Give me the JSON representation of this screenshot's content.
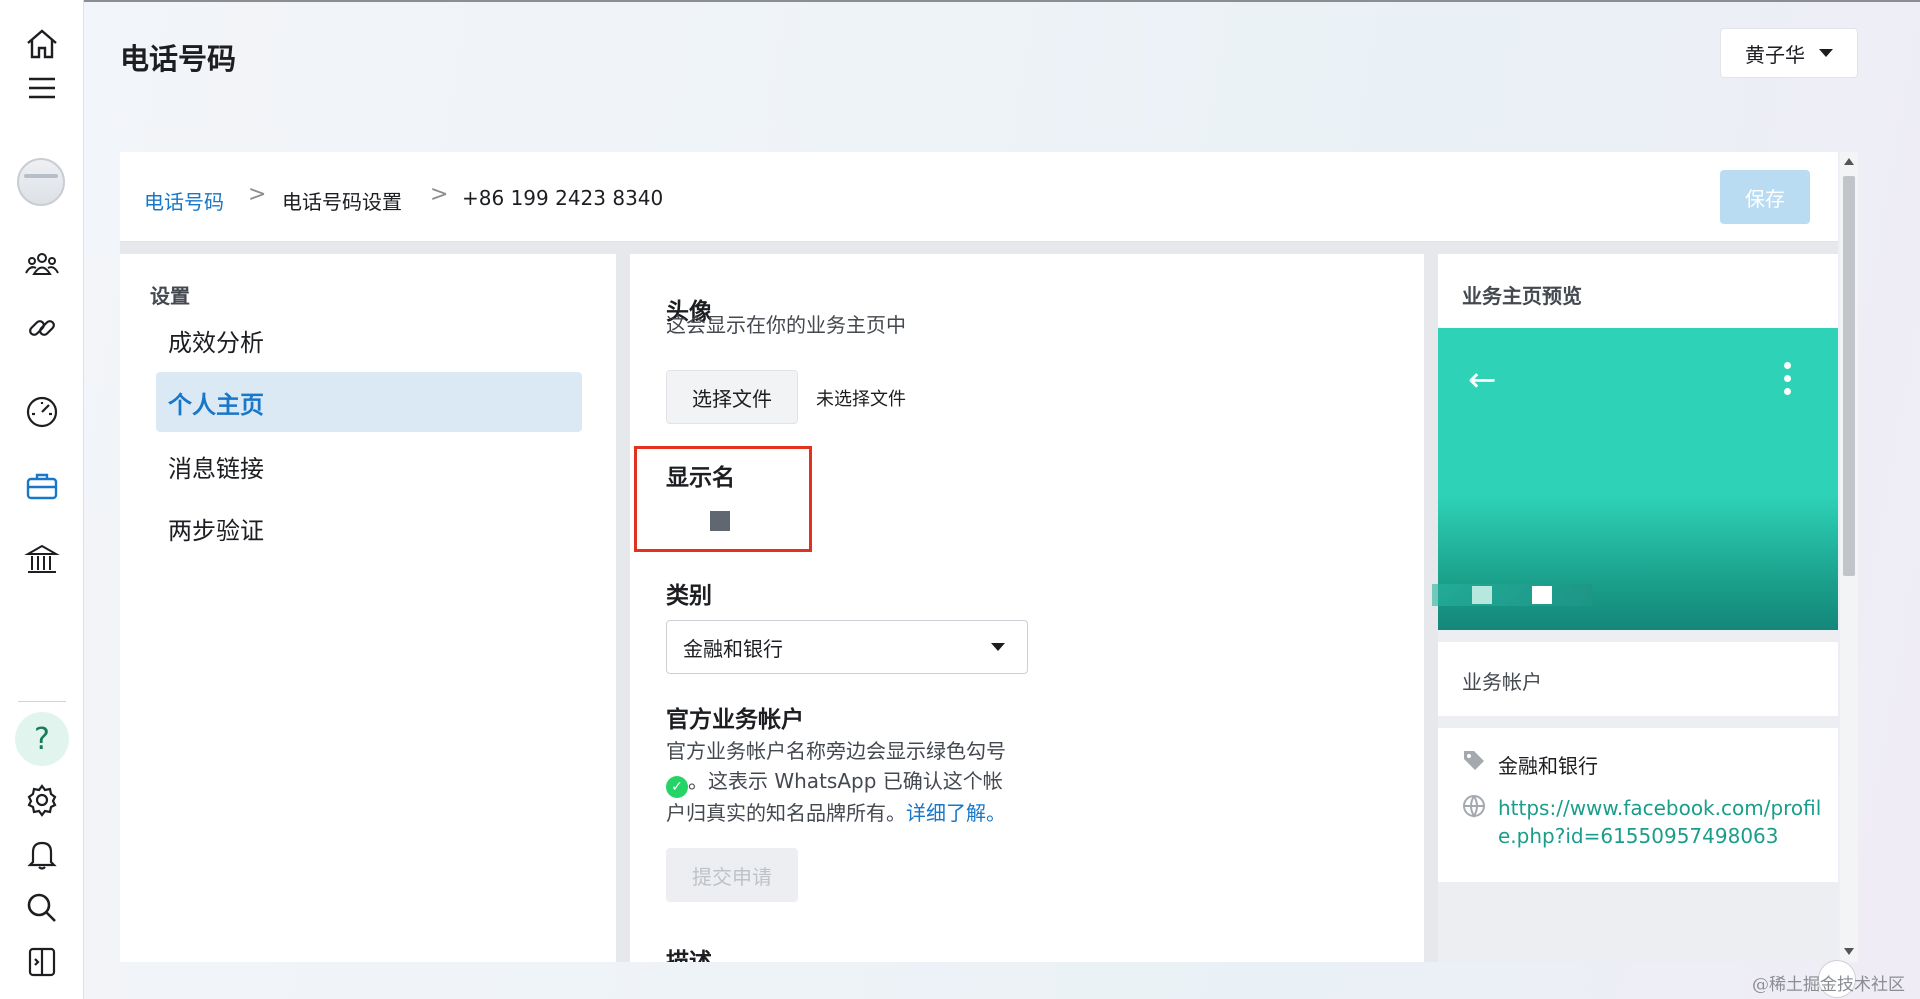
{
  "rail": {
    "icons": [
      "home-icon",
      "menu-icon",
      "avatar",
      "people-icon",
      "link-icon",
      "gauge-icon",
      "briefcase-icon",
      "bank-icon",
      "help-icon",
      "gear-icon",
      "bell-icon",
      "search-icon",
      "panel-toggle-icon"
    ],
    "help_glyph": "?"
  },
  "header": {
    "title": "电话号码",
    "user_name": "黄子华"
  },
  "breadcrumb": {
    "items": [
      "电话号码",
      "电话号码设置",
      "+86 199 2423 8340"
    ],
    "separator": ">"
  },
  "toolbar": {
    "save_label": "保存"
  },
  "settings": {
    "title": "设置",
    "nav": [
      "成效分析",
      "个人主页",
      "消息链接",
      "两步验证"
    ],
    "active_index": 1
  },
  "form": {
    "avatar": {
      "title": "头像",
      "desc": "这会显示在你的业务主页中",
      "file_button": "选择文件",
      "file_status": "未选择文件"
    },
    "display_name": {
      "title": "显示名"
    },
    "category": {
      "title": "类别",
      "value": "金融和银行"
    },
    "official": {
      "title": "官方业务帐户",
      "desc_1": "官方业务帐户名称旁边会显示绿色勾号",
      "desc_2": "。这表示 WhatsApp 已确认这个帐",
      "desc_3": "户归真实的知名品牌所有。",
      "learn_more": "详细了解。",
      "submit_label": "提交申请"
    },
    "description": {
      "title": "描述"
    }
  },
  "preview": {
    "title": "业务主页预览",
    "account_type": "业务帐户",
    "category": "金融和银行",
    "url": "https://www.facebook.com/profile.php?id=61550957498063"
  },
  "watermark": "@稀土掘金技术社区",
  "colors": {
    "accent": "#1877c9",
    "whatsapp_green": "#25d366",
    "hero_teal": "#2ed3b7",
    "highlight_red": "#e0321f"
  }
}
